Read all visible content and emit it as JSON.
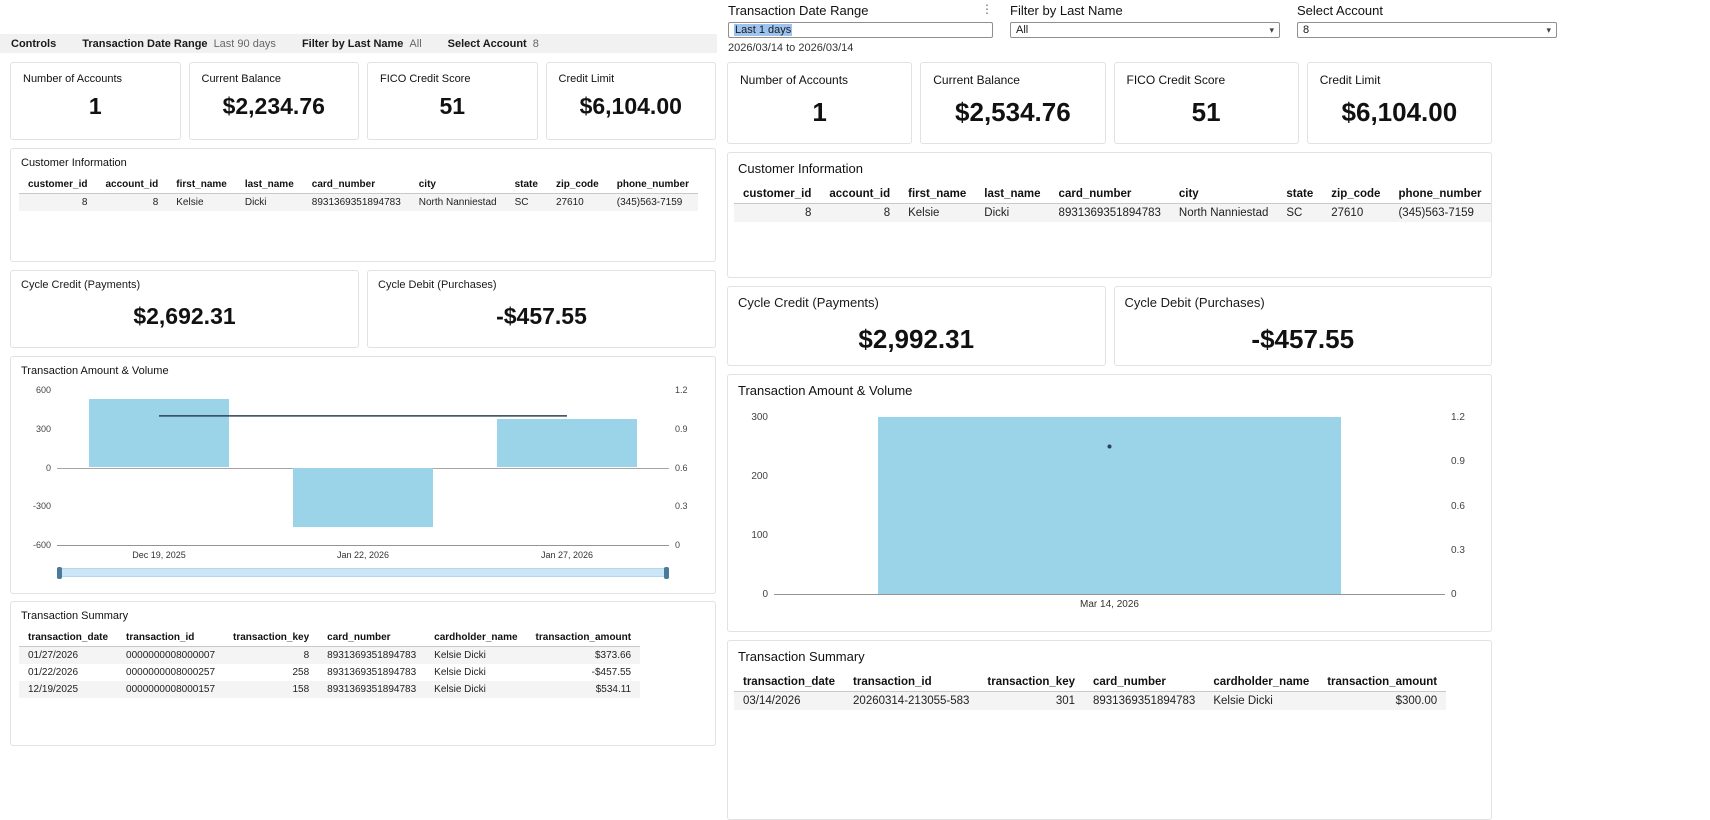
{
  "icons": {
    "kebab_menu": "⋮",
    "chevron_down": "▾"
  },
  "colors": {
    "bar_fill": "#9bd3e8",
    "line_stroke": "#2b4257",
    "selection_highlight": "#9cc3ef",
    "controls_bar_bg": "#f1f1f1"
  },
  "left_dashboard": {
    "controls_bar": {
      "title": "Controls",
      "items": [
        {
          "label": "Transaction Date Range",
          "value": "Last 90 days"
        },
        {
          "label": "Filter by Last Name",
          "value": "All"
        },
        {
          "label": "Select Account",
          "value": "8"
        }
      ]
    },
    "kpis": [
      {
        "label": "Number of Accounts",
        "value": "1"
      },
      {
        "label": "Current Balance",
        "value": "$2,234.76"
      },
      {
        "label": "FICO Credit Score",
        "value": "51"
      },
      {
        "label": "Credit Limit",
        "value": "$6,104.00"
      }
    ],
    "customer_info": {
      "title": "Customer Information",
      "columns": [
        "customer_id",
        "account_id",
        "first_name",
        "last_name",
        "card_number",
        "city",
        "state",
        "zip_code",
        "phone_number"
      ],
      "align": [
        "right",
        "right",
        "left",
        "left",
        "left",
        "left",
        "left",
        "left",
        "left"
      ],
      "rows": [
        [
          "8",
          "8",
          "Kelsie",
          "Dicki",
          "8931369351894783",
          "North Nanniestad",
          "SC",
          "27610",
          "(345)563-7159"
        ]
      ]
    },
    "cycle_credit": {
      "title": "Cycle Credit (Payments)",
      "value": "$2,692.31"
    },
    "cycle_debit": {
      "title": "Cycle Debit (Purchases)",
      "value": "-$457.55"
    },
    "transaction_summary": {
      "title": "Transaction Summary",
      "columns": [
        "transaction_date",
        "transaction_id",
        "transaction_key",
        "card_number",
        "cardholder_name",
        "transaction_amount"
      ],
      "align": [
        "left",
        "left",
        "right",
        "left",
        "left",
        "right"
      ],
      "rows": [
        [
          "01/27/2026",
          "0000000008000007",
          "8",
          "8931369351894783",
          "Kelsie Dicki",
          "$373.66"
        ],
        [
          "01/22/2026",
          "0000000008000257",
          "258",
          "8931369351894783",
          "Kelsie Dicki",
          "-$457.55"
        ],
        [
          "12/19/2025",
          "0000000008000157",
          "158",
          "8931369351894783",
          "Kelsie Dicki",
          "$534.11"
        ]
      ]
    }
  },
  "right_dashboard": {
    "controls": {
      "date_range": {
        "label": "Transaction Date Range",
        "value": "Last 1 days",
        "range_text": "2026/03/14 to 2026/03/14"
      },
      "last_name": {
        "label": "Filter by Last Name",
        "value": "All"
      },
      "account": {
        "label": "Select Account",
        "value": "8"
      }
    },
    "kpis": [
      {
        "label": "Number of Accounts",
        "value": "1"
      },
      {
        "label": "Current Balance",
        "value": "$2,534.76"
      },
      {
        "label": "FICO Credit Score",
        "value": "51"
      },
      {
        "label": "Credit Limit",
        "value": "$6,104.00"
      }
    ],
    "customer_info": {
      "title": "Customer Information",
      "columns": [
        "customer_id",
        "account_id",
        "first_name",
        "last_name",
        "card_number",
        "city",
        "state",
        "zip_code",
        "phone_number"
      ],
      "align": [
        "right",
        "right",
        "left",
        "left",
        "left",
        "left",
        "left",
        "left",
        "left"
      ],
      "rows": [
        [
          "8",
          "8",
          "Kelsie",
          "Dicki",
          "8931369351894783",
          "North Nanniestad",
          "SC",
          "27610",
          "(345)563-7159"
        ]
      ]
    },
    "cycle_credit": {
      "title": "Cycle Credit (Payments)",
      "value": "$2,992.31"
    },
    "cycle_debit": {
      "title": "Cycle Debit (Purchases)",
      "value": "-$457.55"
    },
    "transaction_summary": {
      "title": "Transaction Summary",
      "columns": [
        "transaction_date",
        "transaction_id",
        "transaction_key",
        "card_number",
        "cardholder_name",
        "transaction_amount"
      ],
      "align": [
        "left",
        "left",
        "right",
        "left",
        "left",
        "right"
      ],
      "rows": [
        [
          "03/14/2026",
          "20260314-213055-583",
          "301",
          "8931369351894783",
          "Kelsie Dicki",
          "$300.00"
        ]
      ]
    }
  },
  "chart_data": [
    {
      "id": "left-transaction-chart",
      "type": "bar",
      "title": "Transaction Amount & Volume",
      "categories": [
        "Dec 19, 2025",
        "Jan 22, 2026",
        "Jan 27, 2026"
      ],
      "series": [
        {
          "name": "transaction_amount",
          "type": "bar",
          "axis": "left",
          "values": [
            534.11,
            -457.55,
            373.66
          ]
        },
        {
          "name": "transaction_volume",
          "type": "line",
          "axis": "right",
          "values": [
            1,
            1,
            1
          ]
        }
      ],
      "left_axis": {
        "min": -600,
        "max": 600,
        "ticks": [
          "600",
          "300",
          "0",
          "-300",
          "-600"
        ]
      },
      "right_axis": {
        "min": 0,
        "max": 1.2,
        "ticks": [
          "1.2",
          "0.9",
          "0.6",
          "0.3",
          "0"
        ]
      },
      "grid": false,
      "legend": false,
      "range_slider": true
    },
    {
      "id": "right-transaction-chart",
      "type": "bar",
      "title": "Transaction Amount & Volume",
      "categories": [
        "Mar 14, 2026"
      ],
      "series": [
        {
          "name": "transaction_amount",
          "type": "bar",
          "axis": "left",
          "values": [
            300.0
          ]
        },
        {
          "name": "transaction_volume",
          "type": "point",
          "axis": "right",
          "values": [
            1
          ]
        }
      ],
      "left_axis": {
        "min": 0,
        "max": 300,
        "ticks": [
          "300",
          "200",
          "100",
          "0"
        ]
      },
      "right_axis": {
        "min": 0,
        "max": 1.2,
        "ticks": [
          "1.2",
          "0.9",
          "0.6",
          "0.3",
          "0"
        ]
      },
      "grid": false,
      "legend": false,
      "range_slider": false
    }
  ]
}
